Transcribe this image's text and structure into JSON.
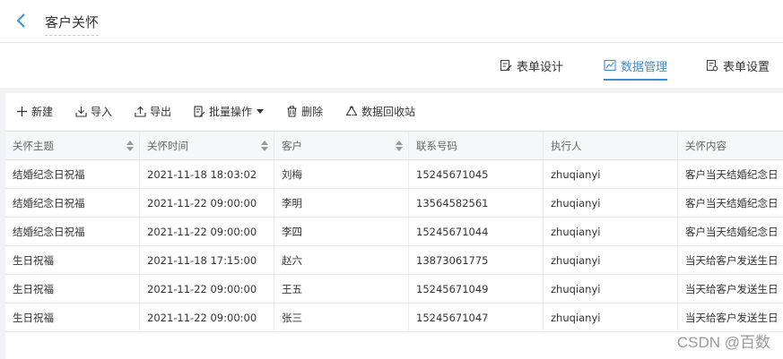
{
  "header": {
    "title": "客户关怀",
    "back_icon": "chevron-left-icon"
  },
  "tabs": [
    {
      "label": "表单设计",
      "icon": "form-edit-icon",
      "active": false
    },
    {
      "label": "数据管理",
      "icon": "chart-icon",
      "active": true
    },
    {
      "label": "表单设置",
      "icon": "settings-doc-icon",
      "active": false
    }
  ],
  "toolbar": {
    "new_label": "新建",
    "import_label": "导入",
    "export_label": "导出",
    "batch_label": "批量操作",
    "delete_label": "删除",
    "recycle_label": "数据回收站"
  },
  "table": {
    "columns": [
      "关怀主题",
      "关怀时间",
      "客户",
      "联系号码",
      "执行人",
      "关怀内容"
    ],
    "rows": [
      [
        "结婚纪念日祝福",
        "2021-11-18 18:03:02",
        "刘梅",
        "15245671045",
        "zhuqianyi",
        "客户当天结婚纪念日"
      ],
      [
        "结婚纪念日祝福",
        "2021-11-22 09:00:00",
        "李明",
        "13564582561",
        "zhuqianyi",
        "客户当天结婚纪念日"
      ],
      [
        "结婚纪念日祝福",
        "2021-11-22 09:00:00",
        "李四",
        "15245671044",
        "zhuqianyi",
        "客户当天结婚纪念日"
      ],
      [
        "生日祝福",
        "2021-11-18 17:15:00",
        "赵六",
        "13873061775",
        "zhuqianyi",
        "当天给客户发送生日"
      ],
      [
        "生日祝福",
        "2021-11-22 09:00:00",
        "王五",
        "15245671049",
        "zhuqianyi",
        "当天给客户发送生日"
      ],
      [
        "生日祝福",
        "2021-11-22 09:00:00",
        "张三",
        "15245671047",
        "zhuqianyi",
        "当天给客户发送生日"
      ]
    ]
  },
  "watermark": "CSDN @百数",
  "colors": {
    "accent": "#3b8fd8",
    "header_bg": "#f6f7f9",
    "page_bg": "#f0f2f5"
  }
}
